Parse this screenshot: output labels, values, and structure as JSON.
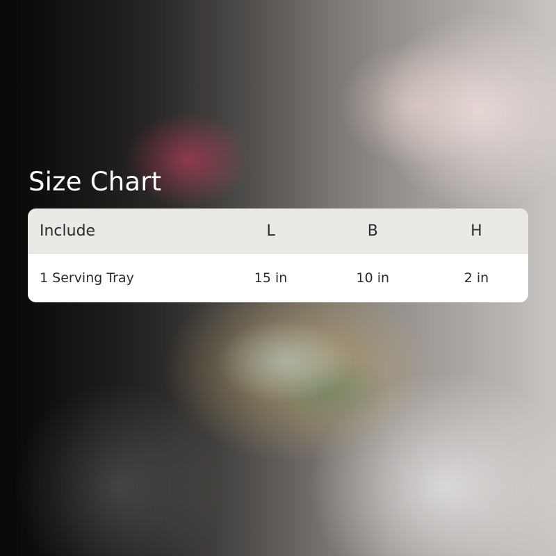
{
  "title": "Size Chart",
  "table": {
    "headers": [
      "Include",
      "L",
      "B",
      "H"
    ],
    "rows": [
      [
        "1 Serving Tray",
        "15 in",
        "10 in",
        "2 in"
      ]
    ]
  }
}
